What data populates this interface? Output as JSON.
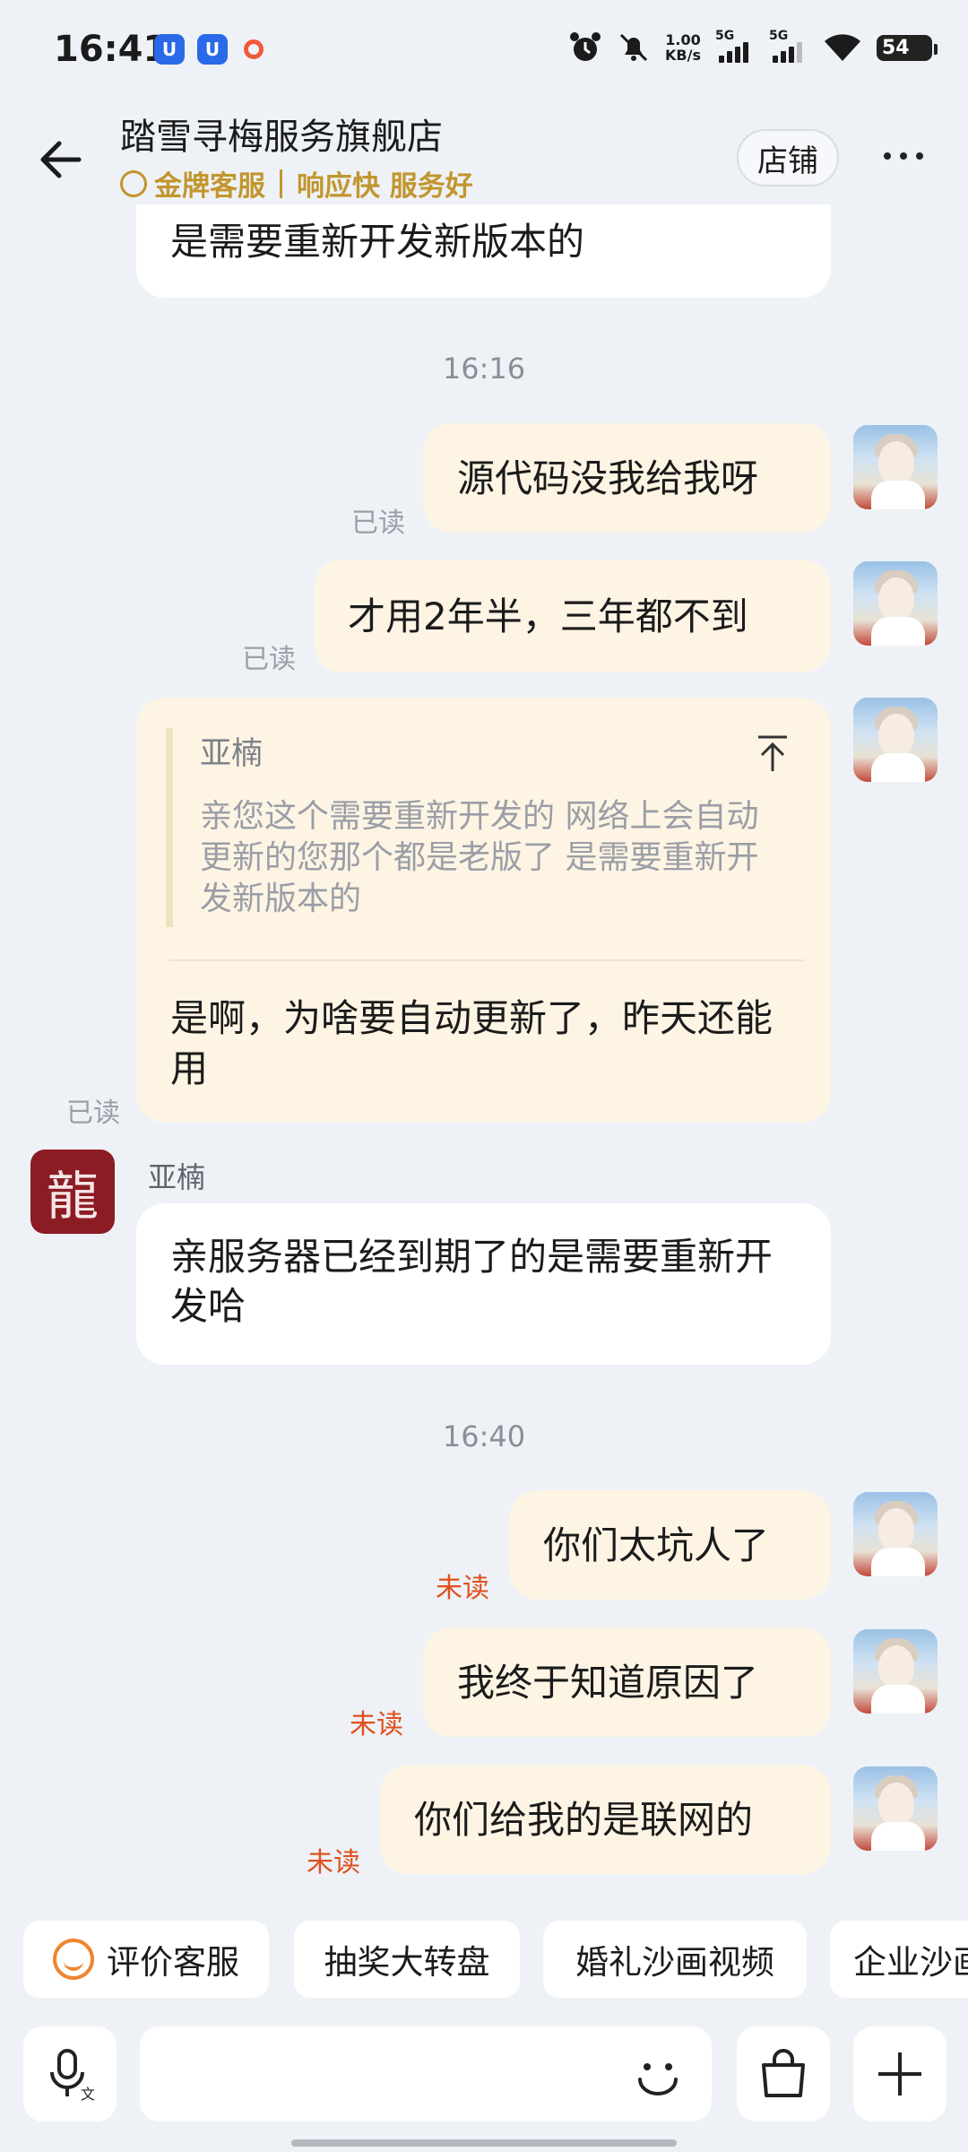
{
  "status_bar": {
    "time": "16:41",
    "net_speed_value": "1.00",
    "net_speed_unit": "KB/s",
    "sim1": "5G",
    "sim2": "5G",
    "battery": "54"
  },
  "header": {
    "shop_name": "踏雪寻梅服务旗舰店",
    "badge": "金牌客服",
    "tagline": "响应快 服务好",
    "store_button": "店铺"
  },
  "messages": {
    "m0": {
      "text": "是需要重新开发新版本的"
    },
    "ts1": "16:16",
    "m1": {
      "text": "源代码没我给我呀",
      "status": "已读"
    },
    "m2": {
      "text": "才用2年半，三年都不到",
      "status": "已读"
    },
    "m3": {
      "quote_name": "亚楠",
      "quote_text": "亲您这个需要重新开发的  网络上会自动更新的您那个都是老版了  是需要重新开发新版本的",
      "text": "是啊，为啥要自动更新了，昨天还能用",
      "status": "已读"
    },
    "m4": {
      "sender": "亚楠",
      "text": "亲服务器已经到期了的是需要重新开发哈"
    },
    "ts2": "16:40",
    "m5": {
      "text": "你们太坑人了",
      "status": "未读"
    },
    "m6": {
      "text": "我终于知道原因了",
      "status": "未读"
    },
    "m7": {
      "text": "你们给我的是联网的",
      "status": "未读"
    }
  },
  "quick_chips": [
    "评价客服",
    "抽奖大转盘",
    "婚礼沙画视频",
    "企业沙画"
  ],
  "colors": {
    "background": "#eef2f7",
    "my_bubble": "#fdf4e4",
    "gold": "#c2962e",
    "unread": "#e0501c",
    "shop_avatar": "#8c1c24"
  },
  "icons": [
    "back-arrow-icon",
    "smiley-icon",
    "more-icon",
    "scroll-to-top-icon",
    "voice-input-icon",
    "emoji-icon",
    "shopping-bag-icon",
    "plus-icon"
  ]
}
